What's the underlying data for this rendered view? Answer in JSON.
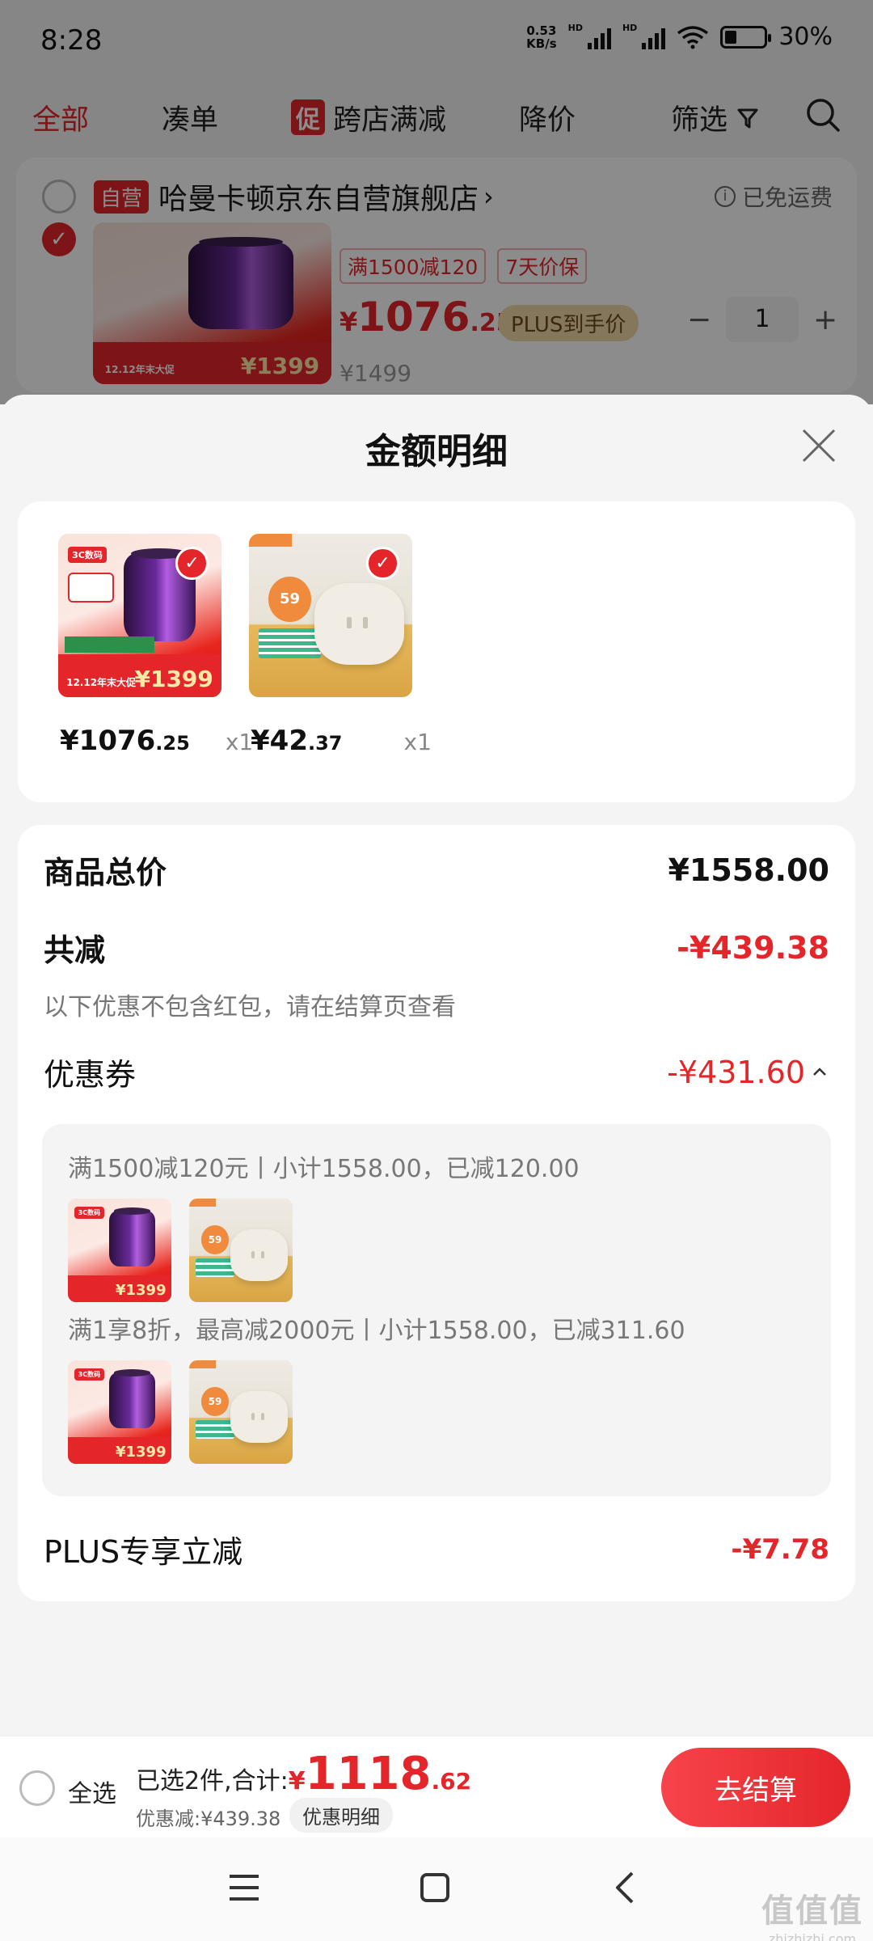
{
  "status_bar": {
    "time": "8:28",
    "net_speed_value": "0.53",
    "net_speed_unit": "KB/s",
    "hd1": "HD",
    "hd2": "HD",
    "battery": "30%",
    "battery_level": 0.3
  },
  "top_nav": {
    "tabs": [
      "全部",
      "凑单",
      "跨店满减",
      "降价"
    ],
    "promo_tag": "促",
    "filter": "筛选"
  },
  "cart": {
    "store_tag": "自营",
    "store_name": "哈曼卡顿京东自营旗舰店",
    "free_shipping": "已免运费",
    "promo_tags": [
      "满1500减120",
      "7天价保"
    ],
    "price_symbol": "¥",
    "price_int": "1076",
    "price_dec": ".25",
    "plus_tag": "PLUS到手价",
    "qty_minus": "−",
    "qty": "1",
    "qty_plus": "+",
    "original_price": "¥1499"
  },
  "product_art": {
    "hk_label": "3C数码",
    "hk_price": "¥1399",
    "hk_promo": "12.12年末大促",
    "cr_badge": "59"
  },
  "sheet": {
    "title": "金额明细",
    "items": [
      {
        "price_main": "¥1076",
        "price_dec": ".25",
        "qty": "x1"
      },
      {
        "price_main": "¥42",
        "price_dec": ".37",
        "qty": "x1"
      }
    ],
    "total_label": "商品总价",
    "total_value": "¥1558.00",
    "reduce_label": "共减",
    "reduce_value": "-¥439.38",
    "note": "以下优惠不包含红包，请在结算页查看",
    "coupon_label": "优惠券",
    "coupon_value": "-¥431.60",
    "coupon_lines": [
      "满1500减120元丨小计1558.00，已减120.00",
      "满1享8折，最高减2000元丨小计1558.00，已减311.60"
    ],
    "plus_label": "PLUS专享立减",
    "plus_value": "-¥7.78"
  },
  "checkout": {
    "select_all": "全选",
    "selected_text": "已选2件,合计:",
    "total_symbol": "¥",
    "total_int": "1118",
    "total_dec": ".62",
    "discount": "优惠减:¥439.38",
    "detail_btn": "优惠明细",
    "checkout_btn": "去结算"
  },
  "watermark": {
    "main": "值值值",
    "sub": "zhizhizhi.com"
  },
  "colors": {
    "accent_red": "#e4262b",
    "plus_gold": "#f3d9a8",
    "sheet_bg": "#f4f4f4"
  }
}
